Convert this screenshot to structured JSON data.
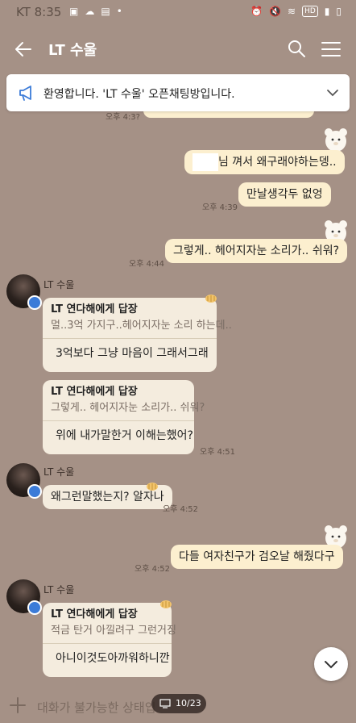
{
  "status_bar": {
    "carrier": "KT",
    "time": "8:35",
    "hd_label": "HD"
  },
  "header": {
    "title": "LT 수울"
  },
  "notice": {
    "text": "환영합니다. 'LT 수울' 오픈채팅방입니다."
  },
  "messages": {
    "m0_time": "오후 4:3?",
    "m1_text": "님 껴서 왜구래야하는뎅..",
    "m2_text": "만날생각두 없엉",
    "m2_time": "오후 4:39",
    "m3_text": "그렇게.. 헤어지자눈 소리가.. 쉬워?",
    "m3_time": "오후 4:44",
    "g1_sender": "LT 수울",
    "g1_r1_head": "LT 연다해에게 답장",
    "g1_r1_quote": "멀..3억 가지구..헤어지자눈 소리 하는데..",
    "g1_r1_text": "3억보다 그냥 마음이 그래서그래",
    "g1_r2_head": "LT 연다해에게 답장",
    "g1_r2_quote": "그렇게.. 헤어지자눈 소리가.. 쉬워?",
    "g1_r2_text": "위에 내가말한거 이해는했어?",
    "g1_time": "오후 4:51",
    "g2_sender": "LT 수울",
    "g2_text": "왜그런말했는지? 알자나",
    "g2_time": "오후 4:52",
    "m4_text": "다들 여자친구가 검오날 해줬다구",
    "m4_time": "오후 4:52",
    "g3_sender": "LT 수울",
    "g3_r1_head": "LT 연다해에게 답장",
    "g3_r1_quote": "적금 탄거 아낄려구 그런거징",
    "g3_r1_text": "아니이것도아까워하니깐"
  },
  "input": {
    "placeholder": "대화가 불가능한 상태입"
  },
  "pager": {
    "label": "10/23"
  },
  "icons": {
    "back": "back-arrow-icon",
    "search": "search-icon",
    "menu": "menu-icon",
    "notice": "megaphone-icon",
    "chevron": "chevron-down-icon",
    "plus": "plus-icon",
    "scroll": "scroll-down-icon"
  },
  "colors": {
    "background": "#a59186",
    "my_bubble": "#fcefcf",
    "other_bubble": "#f4ecde",
    "badge": "#3b7bd8"
  }
}
